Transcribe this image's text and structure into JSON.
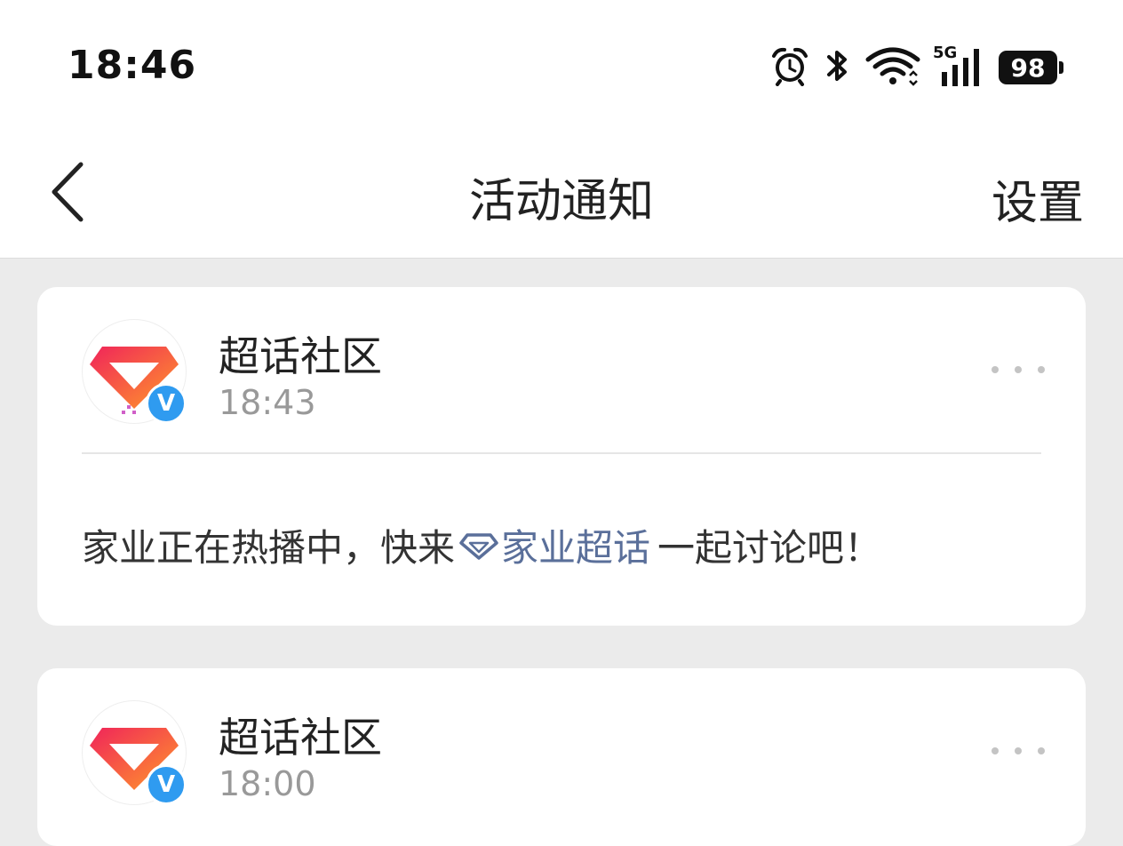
{
  "status_bar": {
    "time": "18:46",
    "network": "5G",
    "battery": "98"
  },
  "nav": {
    "title": "活动通知",
    "settings_label": "设置"
  },
  "notifications": [
    {
      "sender": "超话社区",
      "time": "18:43",
      "message_before": "家业正在热播中，快来",
      "topic_link": "家业超话",
      "message_after": "一起讨论吧！"
    },
    {
      "sender": "超话社区",
      "time": "18:00"
    }
  ],
  "colors": {
    "background": "#ebebeb",
    "card": "#ffffff",
    "link": "#5a6f9a",
    "verified_badge": "#2f9bf0",
    "avatar_gradient_start": "#f0245a",
    "avatar_gradient_end": "#ff9a2a"
  }
}
